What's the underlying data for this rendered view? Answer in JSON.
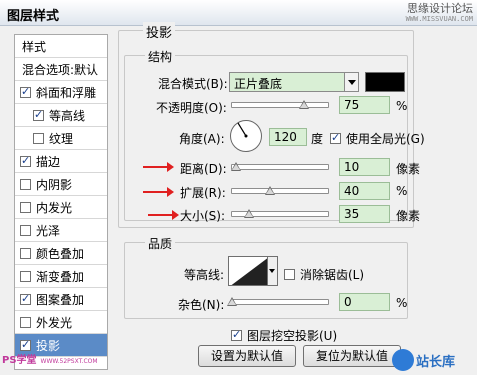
{
  "window": {
    "title": "图层样式"
  },
  "watermark_top": {
    "line1": "思缘设计论坛",
    "line2": "WWW.MISSVUAN.COM"
  },
  "sidebar": {
    "items": [
      {
        "label": "样式",
        "checkbox": false,
        "checked": false,
        "indent": false,
        "active": false
      },
      {
        "label": "混合选项:默认",
        "checkbox": false,
        "checked": false,
        "indent": false,
        "active": false
      },
      {
        "label": "斜面和浮雕",
        "checkbox": true,
        "checked": true,
        "indent": false,
        "active": false
      },
      {
        "label": "等高线",
        "checkbox": true,
        "checked": true,
        "indent": true,
        "active": false
      },
      {
        "label": "纹理",
        "checkbox": true,
        "checked": false,
        "indent": true,
        "active": false
      },
      {
        "label": "描边",
        "checkbox": true,
        "checked": true,
        "indent": false,
        "active": false
      },
      {
        "label": "内阴影",
        "checkbox": true,
        "checked": false,
        "indent": false,
        "active": false
      },
      {
        "label": "内发光",
        "checkbox": true,
        "checked": false,
        "indent": false,
        "active": false
      },
      {
        "label": "光泽",
        "checkbox": true,
        "checked": false,
        "indent": false,
        "active": false
      },
      {
        "label": "颜色叠加",
        "checkbox": true,
        "checked": false,
        "indent": false,
        "active": false
      },
      {
        "label": "渐变叠加",
        "checkbox": true,
        "checked": false,
        "indent": false,
        "active": false
      },
      {
        "label": "图案叠加",
        "checkbox": true,
        "checked": true,
        "indent": false,
        "active": false
      },
      {
        "label": "外发光",
        "checkbox": true,
        "checked": false,
        "indent": false,
        "active": false
      },
      {
        "label": "投影",
        "checkbox": true,
        "checked": true,
        "indent": false,
        "active": true
      }
    ]
  },
  "watermark_ps": {
    "label": "PS学堂",
    "url": "WWW.52PSXT.COM"
  },
  "panel": {
    "title": "投影",
    "structure": {
      "legend": "结构",
      "blend_mode": {
        "label": "混合模式(B):",
        "value": "正片叠底",
        "color": "#000000"
      },
      "opacity": {
        "label": "不透明度(O):",
        "value": "75",
        "unit": "%",
        "level": 0.75
      },
      "angle": {
        "label": "角度(A):",
        "value": "120",
        "unit": "度",
        "global_light_label": "使用全局光(G)",
        "global_light": true
      },
      "distance": {
        "label": "距离(D):",
        "value": "10",
        "unit": "像素",
        "level": 0.04
      },
      "spread": {
        "label": "扩展(R):",
        "value": "40",
        "unit": "%",
        "level": 0.4
      },
      "size": {
        "label": "大小(S):",
        "value": "35",
        "unit": "像素",
        "level": 0.18
      }
    },
    "quality": {
      "legend": "品质",
      "contour_label": "等高线:",
      "anti_alias_label": "消除锯齿(L)",
      "anti_alias": false,
      "noise": {
        "label": "杂色(N):",
        "value": "0",
        "unit": "%",
        "level": 0.0
      }
    },
    "knockout": {
      "label": "图层挖空投影(U)",
      "checked": true
    },
    "buttons": {
      "make_default": "设置为默认值",
      "reset_default": "复位为默认值"
    }
  },
  "watermark_br": {
    "label": "站长库"
  },
  "colors": {
    "active_item": "#5b8bc7",
    "field_bg": "#d9efd5",
    "annotation_arrow": "#e02020"
  }
}
